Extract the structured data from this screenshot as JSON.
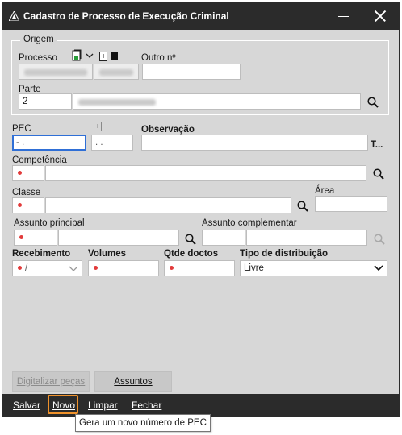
{
  "window": {
    "title": "Cadastro de Processo de Execução Criminal"
  },
  "origem": {
    "group_label": "Origem",
    "processo_label": "Processo",
    "outro_label": "Outro nº",
    "parte_label": "Parte",
    "parte_value": "2"
  },
  "pec": {
    "label": "PEC",
    "value": "  -  .",
    "aux_value": ". .",
    "observacao_label": "Observação",
    "observacao_ellipsis": "T..."
  },
  "competencia": {
    "label": "Competência"
  },
  "classe": {
    "label": "Classe"
  },
  "area": {
    "label": "Área"
  },
  "assunto": {
    "principal_label": "Assunto principal",
    "complementar_label": "Assunto complementar"
  },
  "recebimento": {
    "label": "Recebimento",
    "value": "/"
  },
  "volumes": {
    "label": "Volumes"
  },
  "qtde": {
    "label": "Qtde doctos"
  },
  "tipo": {
    "label": "Tipo de distribuição",
    "value": "Livre"
  },
  "buttons": {
    "digitalizar": "Digitalizar peças",
    "assuntos": "Assuntos"
  },
  "actions": {
    "salvar": "Salvar",
    "novo": "Novo",
    "limpar": "Limpar",
    "fechar": "Fechar"
  },
  "tooltip": "Gera um novo número de PEC",
  "colors": {
    "focus": "#2f6fd6",
    "required": "#e23b3b",
    "highlight": "#f0922b",
    "titlebar": "#2b2b2b"
  }
}
